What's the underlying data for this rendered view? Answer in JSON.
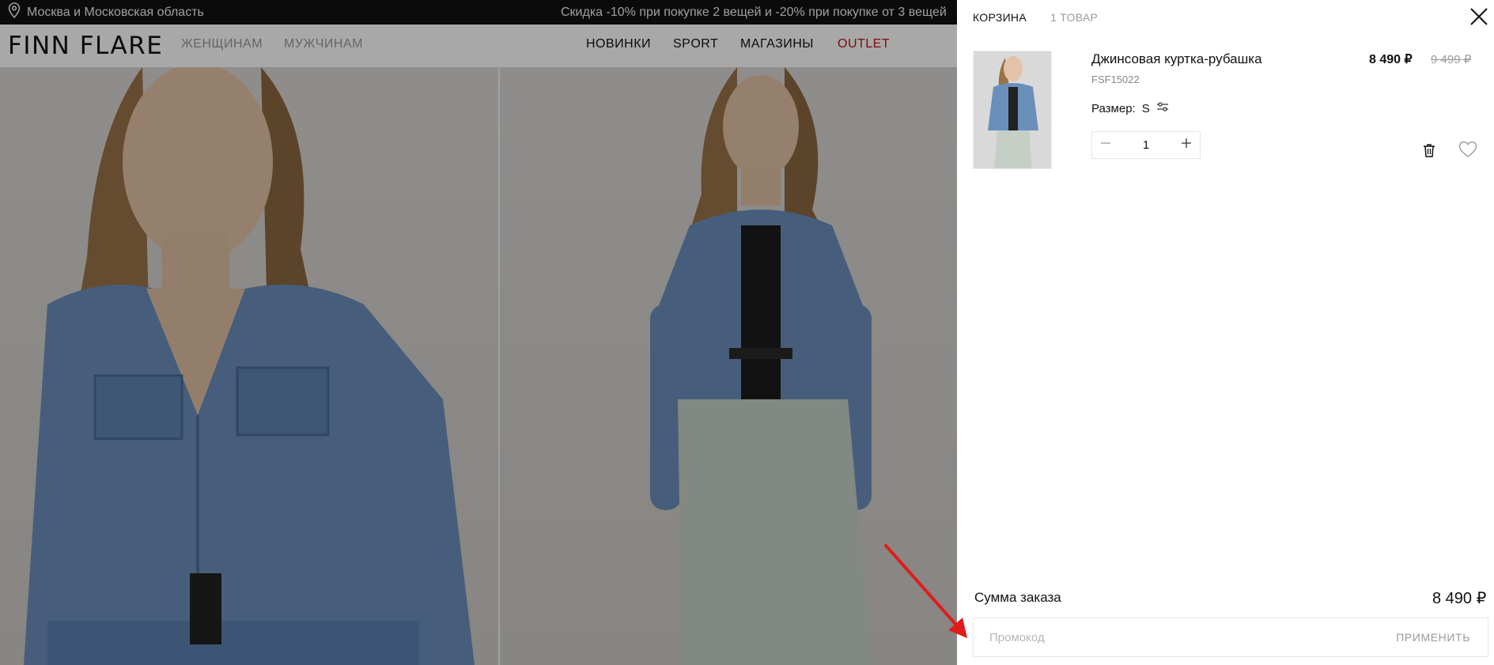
{
  "topbar": {
    "location": "Москва и Московская область",
    "promo": "Скидка -10% при покупке 2 вещей и -20% при покупке от 3 вещей"
  },
  "header": {
    "logo": "FINN FLARE",
    "nav_left": [
      "ЖЕНЩИНАМ",
      "МУЖЧИНАМ"
    ],
    "nav_right": [
      "НОВИНКИ",
      "SPORT",
      "МАГАЗИНЫ",
      "OUTLET"
    ]
  },
  "colors": {
    "outlet": "#c0121b",
    "annotation_arrow": "#e01b1b",
    "denim": "#6a8db8"
  },
  "cart": {
    "title": "КОРЗИНА",
    "count": "1 ТОВАР",
    "item": {
      "name": "Джинсовая куртка-рубашка",
      "sku": "FSF15022",
      "price": "8 490 ₽",
      "old_price": "9 499 ₽",
      "size_label": "Размер:",
      "size_value": "S",
      "quantity": "1"
    },
    "sum_label": "Сумма заказа",
    "sum_value": "8 490 ₽",
    "promo_placeholder": "Промокод",
    "apply_label": "ПРИМЕНИТЬ"
  }
}
